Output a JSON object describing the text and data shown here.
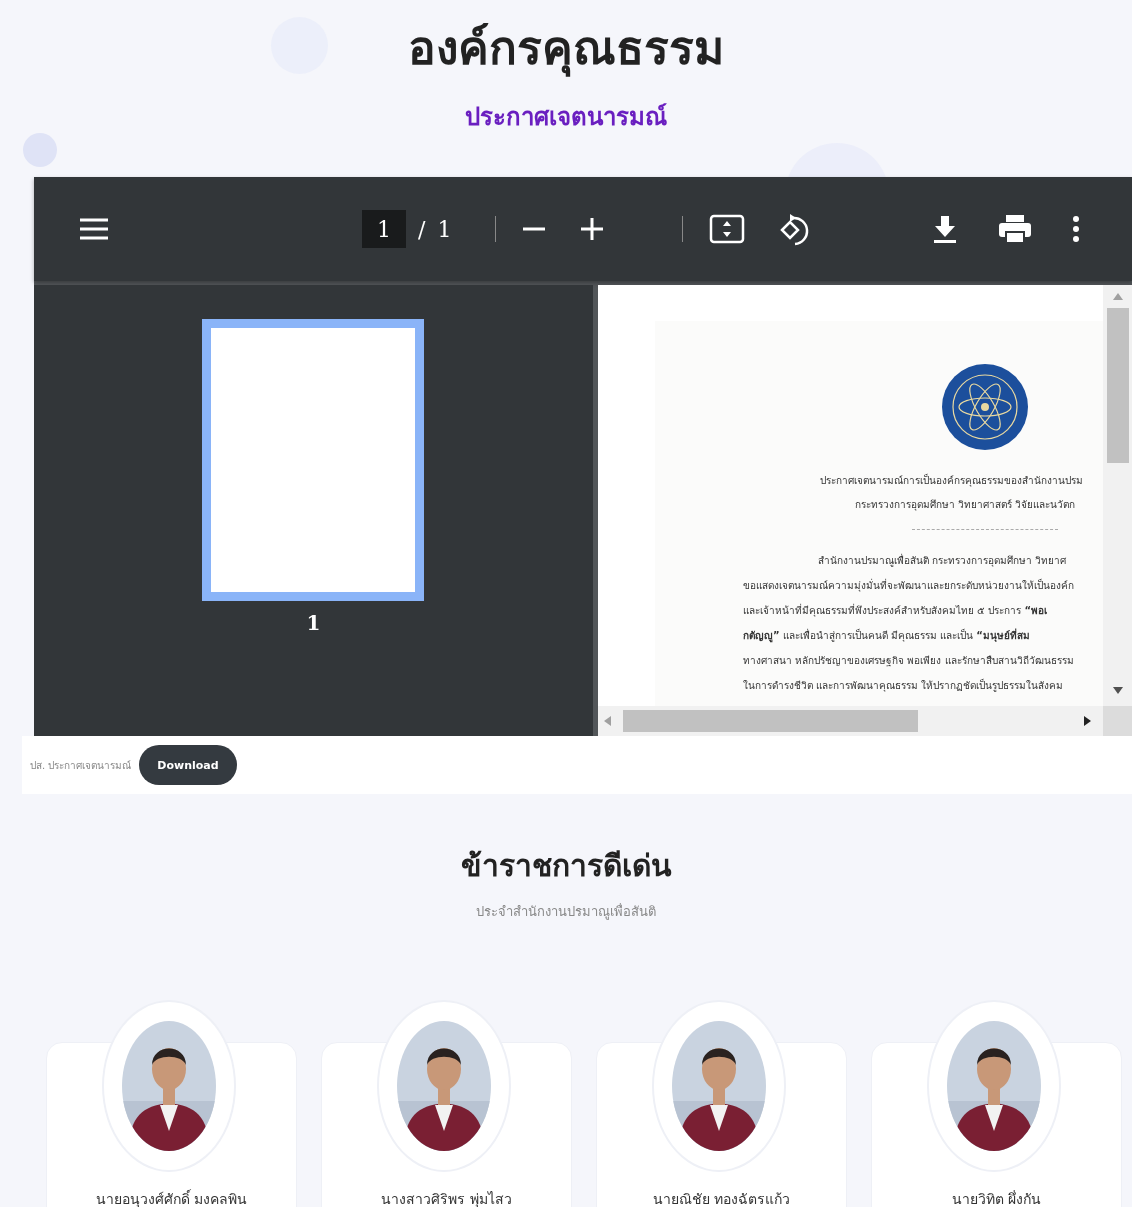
{
  "header": {
    "title": "องค์กรคุณธรรม",
    "subtitle": "ประกาศเจตนารมณ์"
  },
  "viewer": {
    "page_current": "1",
    "page_separator": "/",
    "page_total": "1",
    "thumbnails": [
      {
        "label": "1",
        "selected": true
      }
    ],
    "document": {
      "heading_lines": [
        "ประกาศเจตนารมณ์การเป็นองค์กรคุณธรรมของสำนักงานปรม",
        "กระทรวงการอุดมศึกษา วิทยาศาสตร์ วิจัยและนวัตก"
      ],
      "body_lines": [
        "สำนักงานปรมาณูเพื่อสันติ กระทรวงการอุดมศึกษา วิทยาศ",
        "ขอแสดงเจตนารมณ์ความมุ่งมั่นที่จะพัฒนาและยกระดับหน่วยงานให้เป็นองค์ก",
        "และเจ้าหน้าที่มีคุณธรรมที่พึงประสงค์สำหรับสังคมไทย ๕ ประการ **“พอเ**",
        "**กตัญญู”** และเพื่อนำสู่การเป็นคนดี มีคุณธรรม และเป็น **“มนุษย์ที่สม**",
        "ทางศาสนา หลักปรัชญาของเศรษฐกิจ พอเพียง และรักษาสืบสานวิถีวัฒนธรรม",
        "ในการดำรงชีวิต และการพัฒนาคุณธรรม ให้ปรากฏชัดเป็นรูปธรรมในสังคม"
      ]
    }
  },
  "file": {
    "caption": "ปส. ประกาศเจตนารมณ์",
    "button": "Download"
  },
  "section": {
    "title": "ข้าราชการดีเด่น",
    "subtitle": "ประจำสำนักงานปรมาณูเพื่อสันติ",
    "people": [
      {
        "name": "นายอนุวงศ์ศักดิ์ มงคลพิน"
      },
      {
        "name": "นางสาวศิริพร พุ่มไสว"
      },
      {
        "name": "นายณิชัย ทองฉัตรแก้ว"
      },
      {
        "name": "นายวิทิต ผึ่งกัน"
      }
    ]
  }
}
